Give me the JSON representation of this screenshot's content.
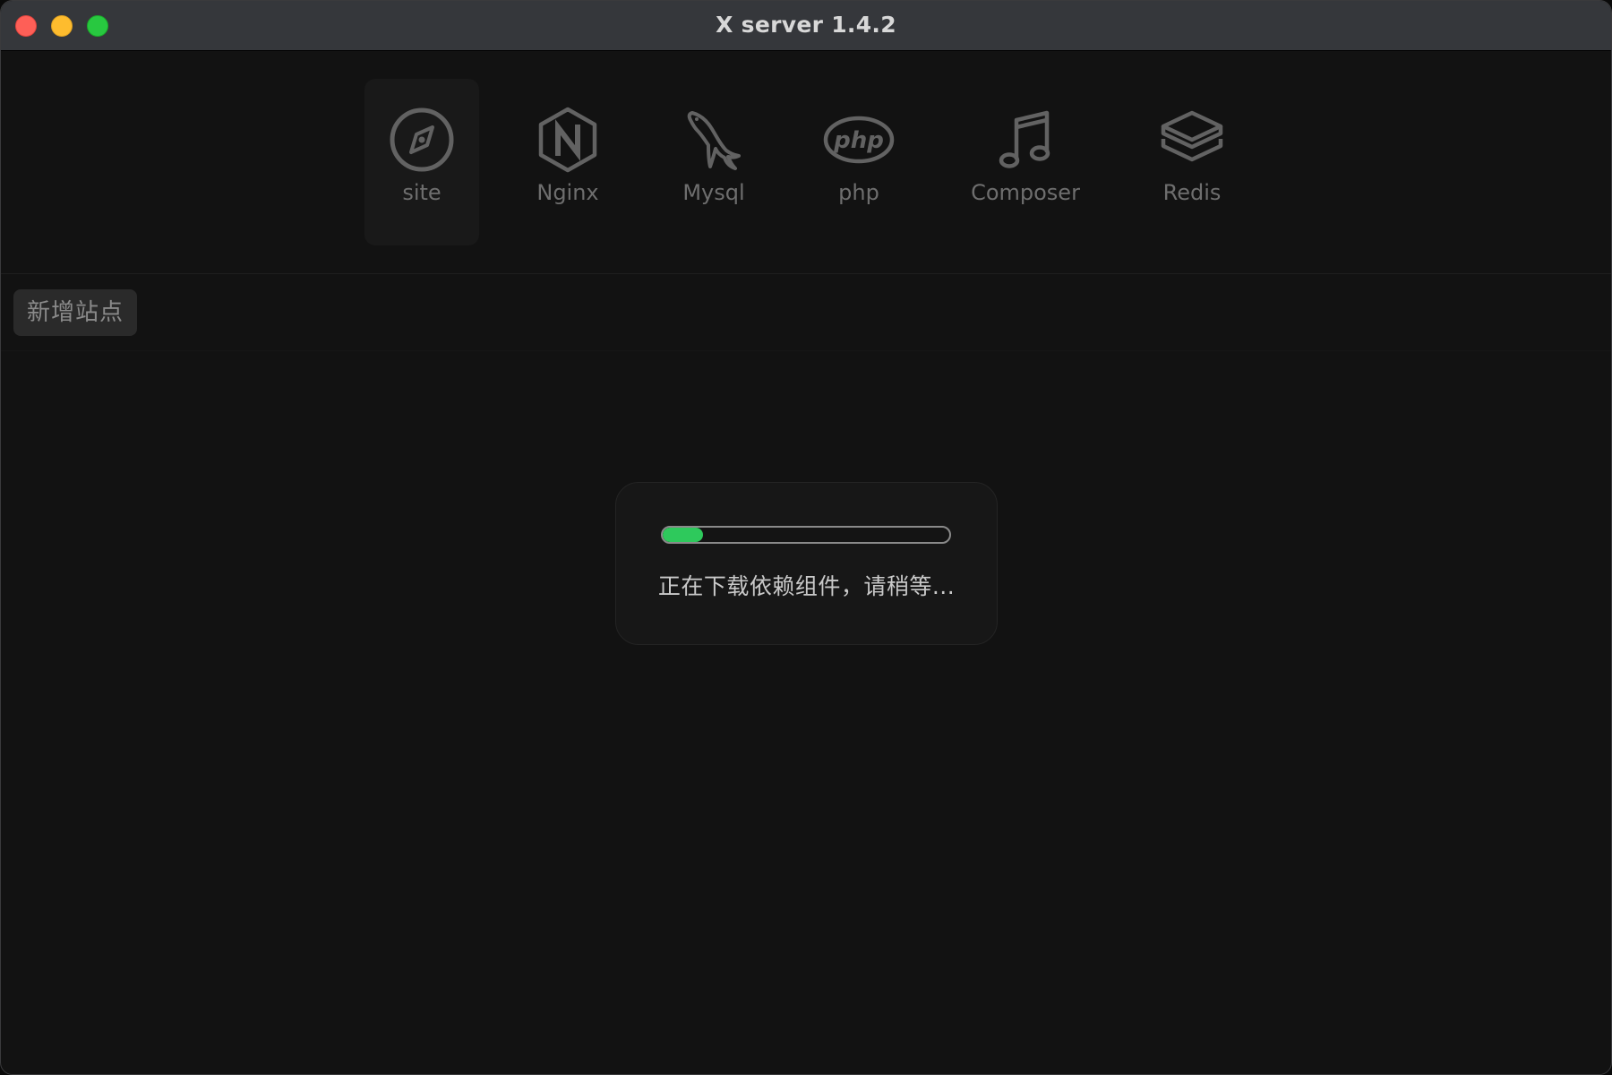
{
  "window": {
    "title": "X server 1.4.2"
  },
  "toolbar": {
    "items": [
      {
        "label": "site",
        "icon": "compass-icon",
        "active": true
      },
      {
        "label": "Nginx",
        "icon": "nginx-hexagon-icon",
        "active": false
      },
      {
        "label": "Mysql",
        "icon": "mysql-dolphin-icon",
        "active": false
      },
      {
        "label": "php",
        "icon": "php-logo-icon",
        "active": false
      },
      {
        "label": "Composer",
        "icon": "music-note-icon",
        "active": false
      },
      {
        "label": "Redis",
        "icon": "stack-layers-icon",
        "active": false
      }
    ]
  },
  "actions": {
    "add_site_label": "新增站点"
  },
  "loading": {
    "progress": 0.14,
    "message": "正在下载依赖组件，请稍等..."
  },
  "colors": {
    "progress_fill": "#2ec95c",
    "traffic_close": "#fe5f57",
    "traffic_minimize": "#febc2e",
    "traffic_maximize": "#28c840"
  }
}
